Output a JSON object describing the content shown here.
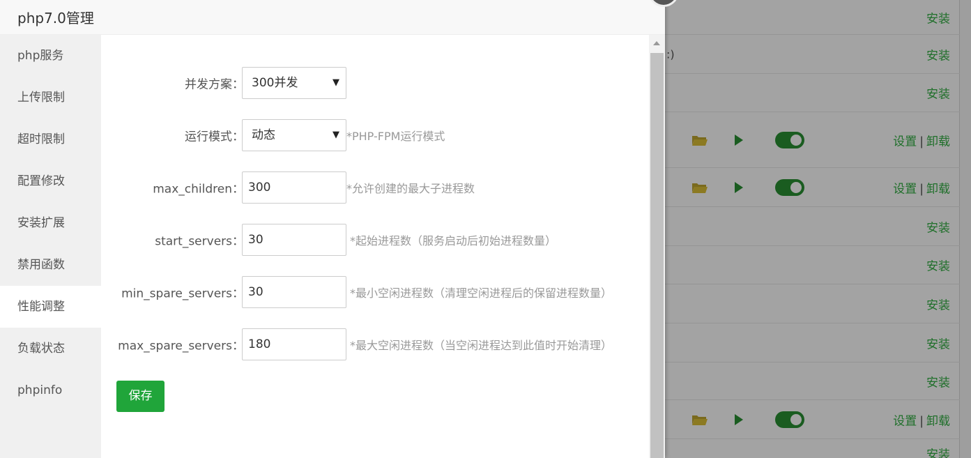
{
  "background": {
    "rows": [
      {
        "fragment": "",
        "actions": [
          "安装"
        ],
        "has_controls": false
      },
      {
        "fragment": ":)",
        "actions": [
          "安装"
        ],
        "has_controls": false
      },
      {
        "fragment": "",
        "actions": [
          "安装"
        ],
        "has_controls": false
      },
      {
        "fragment": "",
        "actions": [
          "设置",
          "卸载"
        ],
        "has_controls": true
      },
      {
        "fragment": "",
        "actions": [
          "设置",
          "卸载"
        ],
        "has_controls": true
      },
      {
        "fragment": "",
        "actions": [
          "安装"
        ],
        "has_controls": false
      },
      {
        "fragment": "",
        "actions": [
          "安装"
        ],
        "has_controls": false
      },
      {
        "fragment": "",
        "actions": [
          "安装"
        ],
        "has_controls": false
      },
      {
        "fragment": "",
        "actions": [
          "安装"
        ],
        "has_controls": false
      },
      {
        "fragment": "",
        "actions": [
          "安装"
        ],
        "has_controls": false
      },
      {
        "fragment": "",
        "actions": [
          "设置",
          "卸载"
        ],
        "has_controls": true
      },
      {
        "fragment": "",
        "actions": [
          "安装"
        ],
        "has_controls": false
      }
    ]
  },
  "modal": {
    "title": "php7.0管理",
    "sidebar": [
      {
        "label": "php服务",
        "active": false
      },
      {
        "label": "上传限制",
        "active": false
      },
      {
        "label": "超时限制",
        "active": false
      },
      {
        "label": "配置修改",
        "active": false
      },
      {
        "label": "安装扩展",
        "active": false
      },
      {
        "label": "禁用函数",
        "active": false
      },
      {
        "label": "性能调整",
        "active": true
      },
      {
        "label": "负载状态",
        "active": false
      },
      {
        "label": "phpinfo",
        "active": false
      }
    ],
    "form": {
      "concurrency": {
        "label": "并发方案：",
        "value": "300并发"
      },
      "run_mode": {
        "label": "运行模式：",
        "value": "动态",
        "hint": "*PHP-FPM运行模式"
      },
      "max_children": {
        "label": "max_children：",
        "value": "300",
        "hint": "*允许创建的最大子进程数"
      },
      "start_servers": {
        "label": "start_servers：",
        "value": "30",
        "hint": "*起始进程数（服务启动后初始进程数量）"
      },
      "min_spare_servers": {
        "label": "min_spare_servers：",
        "value": "30",
        "hint": "*最小空闲进程数（清理空闲进程后的保留进程数量）"
      },
      "max_spare_servers": {
        "label": "max_spare_servers：",
        "value": "180",
        "hint": "*最大空闲进程数（当空闲进程达到此值时开始清理）"
      }
    },
    "save_label": "保存"
  },
  "colors": {
    "accent": "#20a53a",
    "link": "#1f6f2a",
    "overlay": "#a3a3a3"
  },
  "icons": {
    "dropdown": "▼",
    "folder": "folder-icon",
    "play": "play-icon",
    "toggle": "toggle-switch-icon"
  }
}
